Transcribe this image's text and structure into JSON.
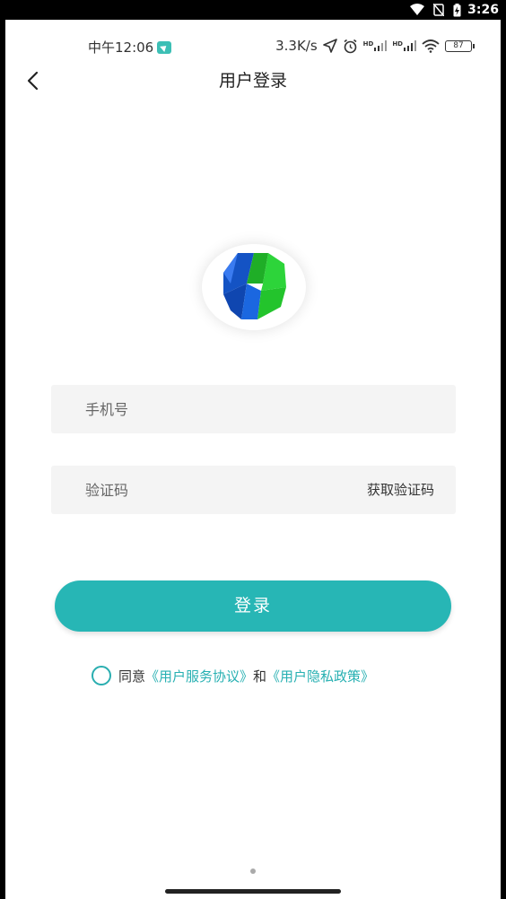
{
  "outer_status": {
    "time": "3:26"
  },
  "inner_status": {
    "time": "中午12:06",
    "speed": "3.3K/s",
    "hd1": "HD",
    "hd2": "HD",
    "battery": "87"
  },
  "header": {
    "title": "用户登录"
  },
  "form": {
    "phone_placeholder": "手机号",
    "code_placeholder": "验证码",
    "get_code_label": "获取验证码",
    "login_label": "登录"
  },
  "agreement": {
    "prefix": "同意",
    "service_link": "《用户服务协议》",
    "and": "和",
    "privacy_link": "《用户隐私政策》"
  },
  "colors": {
    "accent": "#27b6b5",
    "link": "#27b0b2"
  }
}
